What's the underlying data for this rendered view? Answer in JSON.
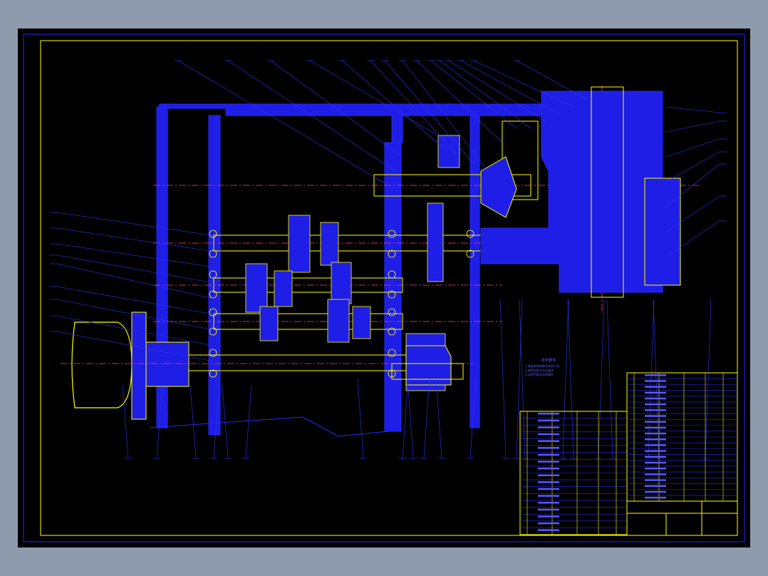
{
  "viewer": {
    "background_color": "#8e9bad",
    "canvas_color": "#000000"
  },
  "drawing": {
    "colors": {
      "outline": "#2828ff",
      "section_fill": "#1e1ee6",
      "highlight": "#ffff00",
      "centerline": "#ff3c8c",
      "leader": "#3232ff",
      "text": "#5a5aff"
    },
    "callout_count_top": 26,
    "callout_count_bottom": 17,
    "callout_count_left": 11,
    "callout_count_right": 9,
    "technical_note": [
      "技术要求",
      "1.装配前所有零件清洗干净",
      "2.各密封处不允许漏油",
      "3.运转平稳无异常噪声"
    ],
    "parts_list_rows": 18,
    "parts_list_right_rows": 22,
    "title_block": {
      "title": "",
      "drawing_no": ""
    }
  }
}
